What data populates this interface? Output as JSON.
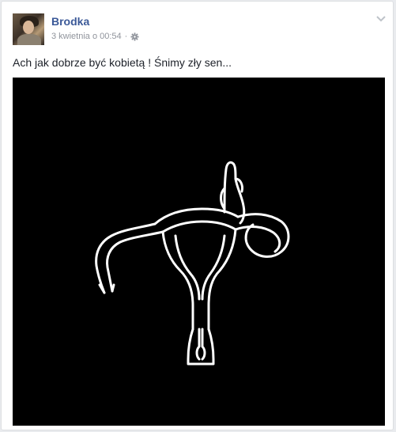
{
  "post": {
    "author": "Brodka",
    "timestamp": "3 kwietnia o 00:54",
    "separator": "·",
    "privacy_icon": "gear-icon",
    "menu_icon": "chevron-down-icon",
    "text": "Ach jak dobrze być kobietą ! Śnimy zły sen...",
    "photo": {
      "description_icon": "uterus-middle-finger-neon-outline"
    }
  },
  "colors": {
    "author_link": "#3b5998",
    "meta_text": "#90949c",
    "photo_background": "#000000",
    "outline": "#ffffff"
  }
}
